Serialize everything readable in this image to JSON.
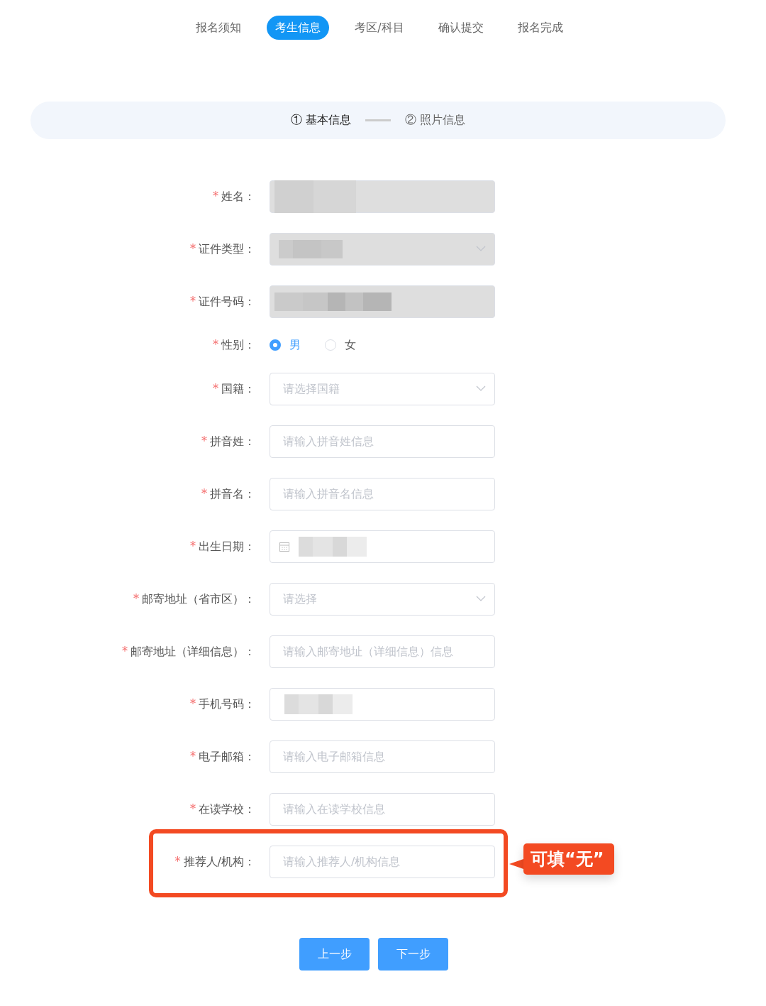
{
  "tabs": [
    {
      "label": "报名须知",
      "selected": false
    },
    {
      "label": "考生信息",
      "selected": true
    },
    {
      "label": "考区/科目",
      "selected": false
    },
    {
      "label": "确认提交",
      "selected": false
    },
    {
      "label": "报名完成",
      "selected": false
    }
  ],
  "steps": [
    {
      "number": "①",
      "label": "基本信息",
      "selected": true
    },
    {
      "number": "②",
      "label": "照片信息",
      "selected": false
    }
  ],
  "form": [
    {
      "label": "姓名：",
      "required_mark": "*",
      "kind": "text",
      "disabled": true,
      "masked": true
    },
    {
      "label": "证件类型：",
      "required_mark": "*",
      "kind": "select",
      "disabled": true,
      "masked": true
    },
    {
      "label": "证件号码：",
      "required_mark": "*",
      "kind": "text",
      "disabled": true,
      "masked": true
    },
    {
      "label": "性别：",
      "required_mark": "*",
      "kind": "radio",
      "options": [
        {
          "label": "男",
          "selected": true
        },
        {
          "label": "女",
          "selected": false
        }
      ]
    },
    {
      "label": "国籍：",
      "required_mark": "*",
      "kind": "select",
      "disabled": false,
      "placeholder": "请选择国籍"
    },
    {
      "label": "拼音姓：",
      "required_mark": "*",
      "kind": "text",
      "disabled": false,
      "placeholder": "请输入拼音姓信息"
    },
    {
      "label": "拼音名：",
      "required_mark": "*",
      "kind": "text",
      "disabled": false,
      "placeholder": "请输入拼音名信息"
    },
    {
      "label": "出生日期：",
      "required_mark": "*",
      "kind": "date",
      "disabled": false,
      "masked": true
    },
    {
      "label": "邮寄地址（省市区）：",
      "required_mark": "*",
      "kind": "select",
      "disabled": false,
      "placeholder": "请选择"
    },
    {
      "label": "邮寄地址（详细信息）：",
      "required_mark": "*",
      "kind": "text",
      "disabled": false,
      "placeholder": "请输入邮寄地址（详细信息）信息"
    },
    {
      "label": "手机号码：",
      "required_mark": "*",
      "kind": "text",
      "disabled": false,
      "masked": true
    },
    {
      "label": "电子邮箱：",
      "required_mark": "*",
      "kind": "text",
      "disabled": false,
      "placeholder": "请输入电子邮箱信息"
    },
    {
      "label": "在读学校：",
      "required_mark": "*",
      "kind": "text",
      "disabled": false,
      "placeholder": "请输入在读学校信息"
    },
    {
      "label": "推荐人/机构：",
      "required_mark": "*",
      "kind": "text",
      "disabled": false,
      "placeholder": "请输入推荐人/机构信息",
      "highlighted": true
    }
  ],
  "callout": "可填“无”",
  "buttons": [
    "上一步",
    "下一步"
  ]
}
